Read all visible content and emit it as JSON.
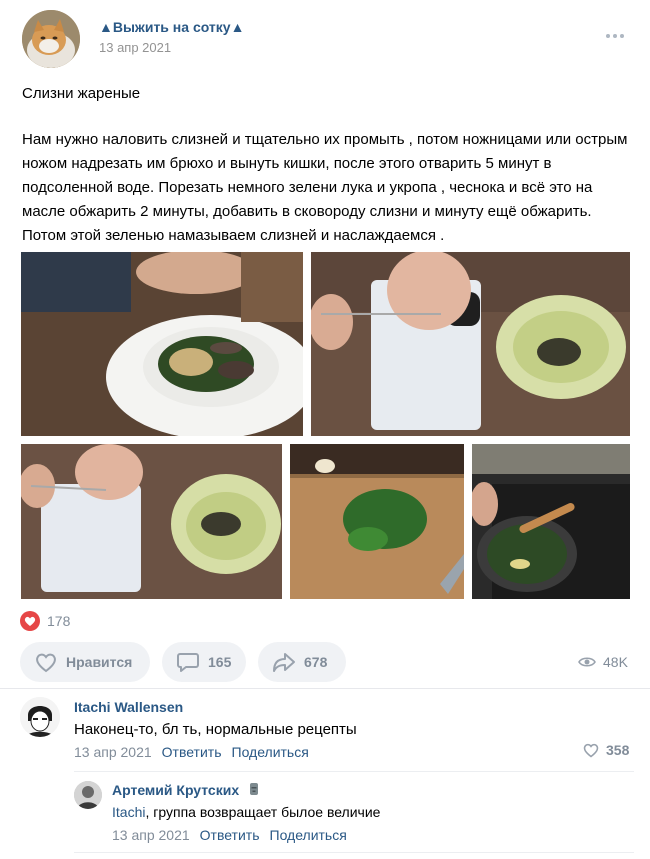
{
  "post": {
    "group_name": "▲Выжить на сотку▲",
    "date": "13 апр 2021",
    "title": "Слизни жареные",
    "text": "Нам нужно наловить слизней и тщательно их промыть , потом ножницами или острым ножом надрезать им брюхо и вынуть кишки, после этого отварить 5 минут в подсоленной воде. Порезать немного зелени лука и укропа , чеснока и всё это на масле обжарить 2 минуты, добавить в сковороду слизни и минуту ещё обжарить. Потом этой зеленью намазываем слизней и наслаждаемся ."
  },
  "stats": {
    "likes": "178",
    "like_button_label": "Нравится",
    "comments": "165",
    "shares": "678",
    "views": "48K"
  },
  "comments": [
    {
      "author": "Itachi Wallensen",
      "text": "Наконец-то, бл   ть, нормальные рецепты",
      "date": "13 апр 2021",
      "reply_label": "Ответить",
      "share_label": "Поделиться",
      "likes": "358"
    },
    {
      "author": "Артемий Крутских",
      "mention": "Itachi",
      "text": ", группа возвращает былое величие",
      "date": "13 апр 2021",
      "reply_label": "Ответить",
      "share_label": "Поделиться"
    }
  ],
  "icons": {
    "more": "more-icon",
    "heart": "heart-icon",
    "comment": "comment-icon",
    "share": "share-icon",
    "views": "eye-icon"
  },
  "colors": {
    "link": "#2a5885",
    "secondary": "#818c99",
    "like_red": "#e64646",
    "button_bg": "#f0f2f5"
  }
}
